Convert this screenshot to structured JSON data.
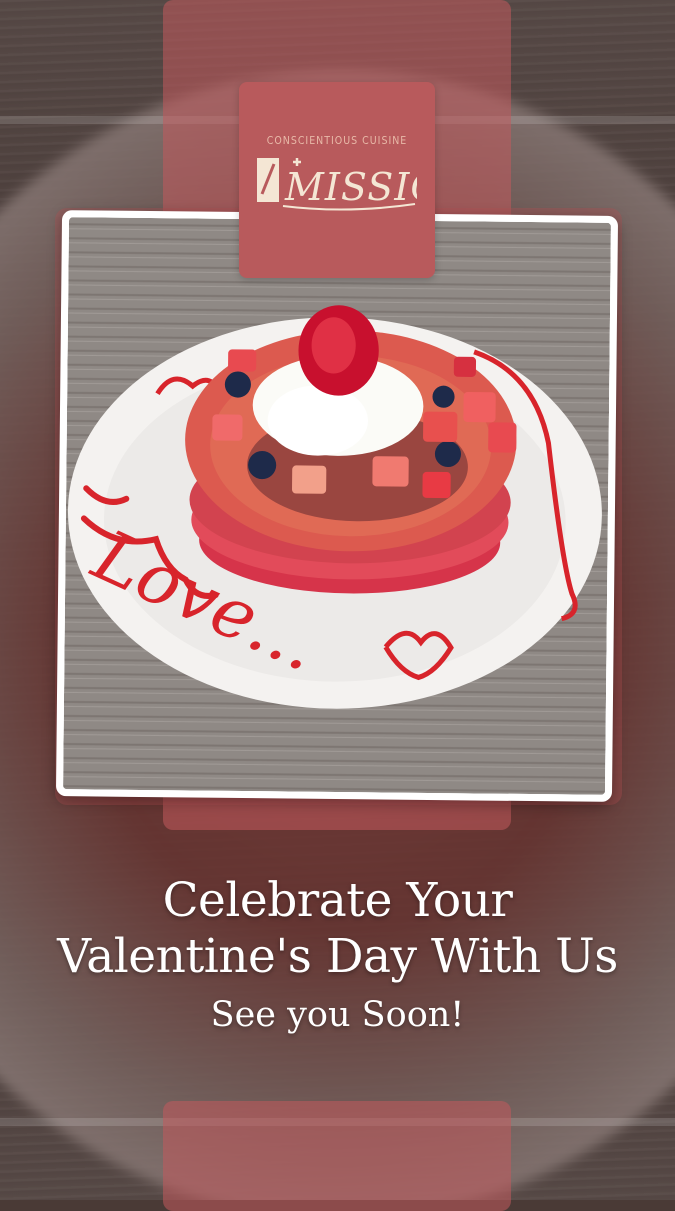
{
  "logo": {
    "tagline": "CONSCIENTIOUS CUISINE",
    "wordmark": "MISSION"
  },
  "photo": {
    "plate_writing": "Love..."
  },
  "headline": {
    "line1": "Celebrate Your",
    "line2": "Valentine's Day With Us"
  },
  "subheadline": "See you Soon!",
  "colors": {
    "brand": "#b85a5c",
    "tagline": "#e8b9a8",
    "text": "#ffffff"
  }
}
